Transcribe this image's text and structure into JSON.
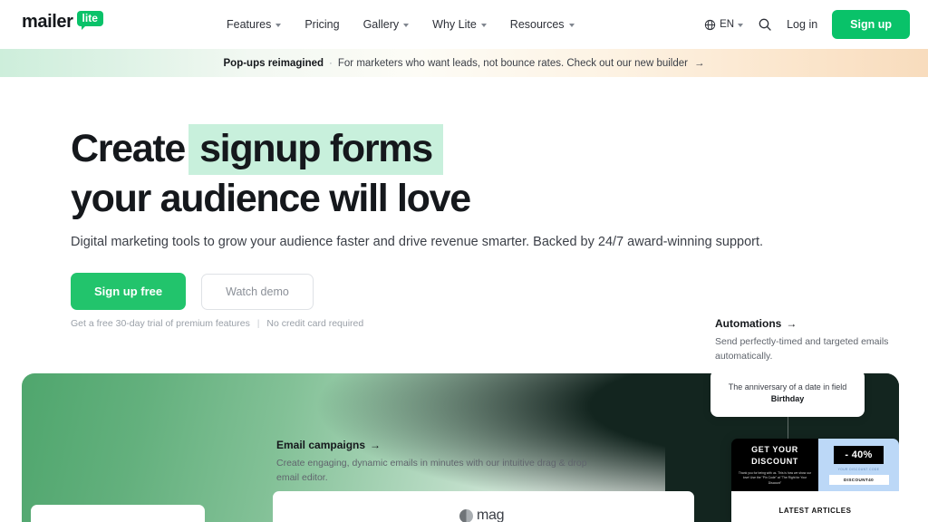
{
  "brand": {
    "logo_word": "mailer",
    "logo_badge": "lite",
    "accent_green": "#09C269",
    "cta_green": "#22c46c",
    "highlight_green": "#c8f0dc",
    "dark_panel": "#13251f"
  },
  "nav": {
    "items": [
      {
        "label": "Features",
        "has_caret": true
      },
      {
        "label": "Pricing",
        "has_caret": false
      },
      {
        "label": "Gallery",
        "has_caret": true
      },
      {
        "label": "Why Lite",
        "has_caret": true
      },
      {
        "label": "Resources",
        "has_caret": true
      }
    ],
    "language": "EN",
    "login_label": "Log in",
    "signup_label": "Sign up"
  },
  "announcement": {
    "bold": "Pop-ups reimagined",
    "separator": "·",
    "text": "For marketers who want leads, not bounce rates. Check out our new builder",
    "arrow": "→"
  },
  "hero": {
    "headline_part1": "Create",
    "headline_highlight": "signup forms",
    "headline_line2": "your audience will love",
    "subhead": "Digital marketing tools to grow your audience faster and drive revenue smarter. Backed by 24/7 award-winning support.",
    "primary_cta": "Sign up free",
    "secondary_cta": "Watch demo",
    "fineprint_left": "Get a free 30-day trial of premium features",
    "fineprint_divider": "|",
    "fineprint_right": "No credit card required"
  },
  "features": {
    "automations": {
      "title": "Automations",
      "arrow": "→",
      "desc": "Send perfectly-timed and targeted emails automatically."
    },
    "email_campaigns": {
      "title": "Email campaigns",
      "arrow": "→",
      "desc": "Create engaging, dynamic emails in minutes with our intuitive drag & drop email editor."
    }
  },
  "showcase": {
    "tooltip_text": "The anniversary of a date in field ",
    "tooltip_bold": "Birthday",
    "mag_logo_text": "mag",
    "email_mock": {
      "heading_line1": "GET YOUR",
      "heading_line2": "DISCOUNT",
      "body": "Thank you for being with us. This is how we show our love! Use the \"Pin Code\" at \"The Right for Your Discount\"",
      "discount_badge": "- 40%",
      "code_label": "YOUR DISCOUNT CODE",
      "code_value": "DISCOUNT40",
      "articles_title": "LATEST ARTICLES"
    }
  }
}
